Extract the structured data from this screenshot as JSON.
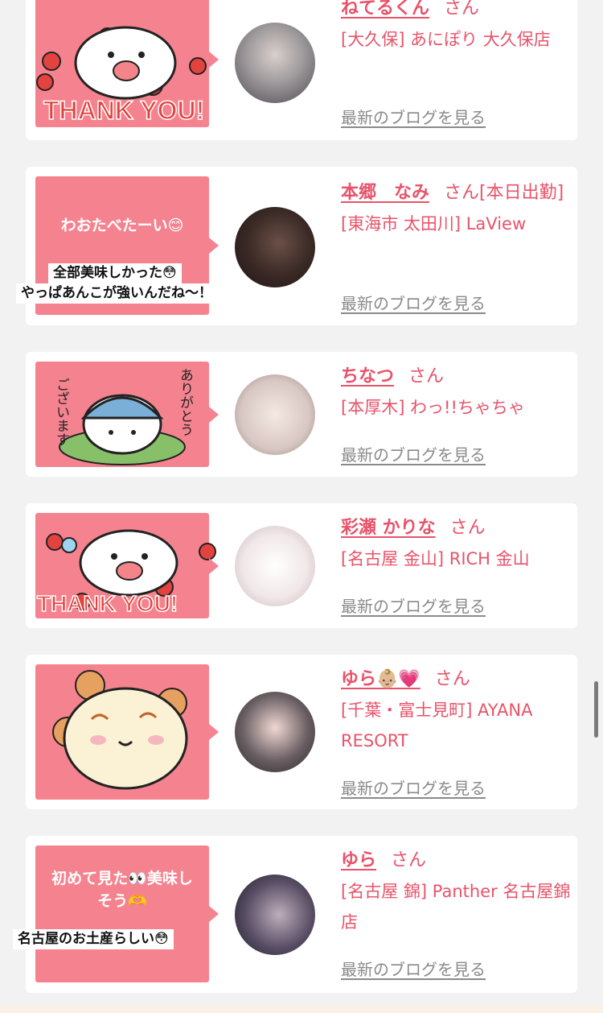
{
  "cards": [
    {
      "name": "ねてるくん",
      "san": "さん",
      "shop": "[大久保] あにぽり 大久保店",
      "blog": "最新のブログを見る",
      "sticker_text": "THANK YOU!"
    },
    {
      "name": "本郷　なみ",
      "san": "さん[本日出勤]",
      "shop": "[東海市 太田川] LaView",
      "blog": "最新のブログを見る",
      "message": "わおたべたーい😊",
      "caption1": "全部美味しかった😳",
      "caption2": "やっぱあんこが強いんだね〜！"
    },
    {
      "name": "ちなつ",
      "san": "さん",
      "shop": "[本厚木] わっ!!ちゃちゃ",
      "blog": "最新のブログを見る",
      "sticker_left": "ございます",
      "sticker_right": "ありがとう"
    },
    {
      "name": "彩瀬 かりな",
      "san": "さん",
      "shop": "[名古屋 金山] RICH 金山",
      "blog": "最新のブログを見る",
      "sticker_text": "THANK YOU!"
    },
    {
      "name": "ゆら👶🏼💗",
      "san": "さん",
      "shop": "[千葉・富士見町] AYANA RESORT",
      "blog": "最新のブログを見る"
    },
    {
      "name": "ゆら",
      "san": "さん",
      "shop": "[名古屋 錦] Panther 名古屋錦店",
      "blog": "最新のブログを見る",
      "message": "初めて見た👀美味しそう🫶",
      "caption1": "名古屋のお土産らしい😳"
    }
  ],
  "colors": {
    "accent": "#e8536a",
    "bubble": "#f4838f",
    "background": "#f2f2f2",
    "link_gray": "#8a8a8a"
  }
}
